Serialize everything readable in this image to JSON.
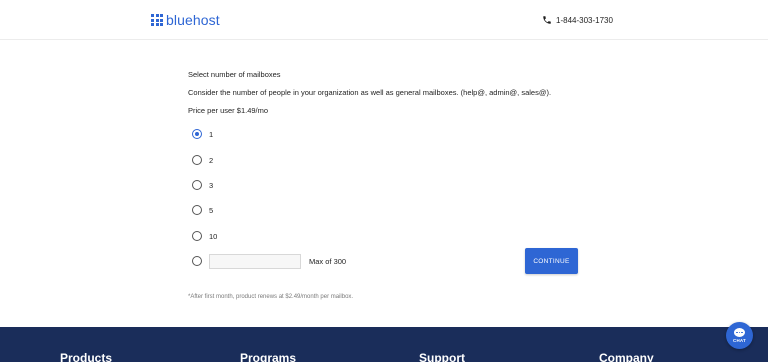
{
  "header": {
    "logo_text": "bluehost",
    "phone": "1-844-303-1730"
  },
  "main": {
    "heading": "Select number of mailboxes",
    "description": "Consider the number of people in your organization as well as general mailboxes. (help@, admin@, sales@).",
    "price": "Price per user $1.49/mo",
    "options": [
      {
        "label": "1",
        "selected": true
      },
      {
        "label": "2",
        "selected": false
      },
      {
        "label": "3",
        "selected": false
      },
      {
        "label": "5",
        "selected": false
      },
      {
        "label": "10",
        "selected": false
      }
    ],
    "custom_input_value": "",
    "custom_max_label": "Max of 300",
    "continue_label": "CONTINUE",
    "footnote": "*After first month, product renews at $2.49/month per mailbox."
  },
  "footer": {
    "columns": [
      "Products",
      "Programs",
      "Support",
      "Company"
    ]
  },
  "chat": {
    "label": "CHAT"
  },
  "colors": {
    "brand_blue": "#2e66d4",
    "footer_navy": "#1a2d5a"
  }
}
